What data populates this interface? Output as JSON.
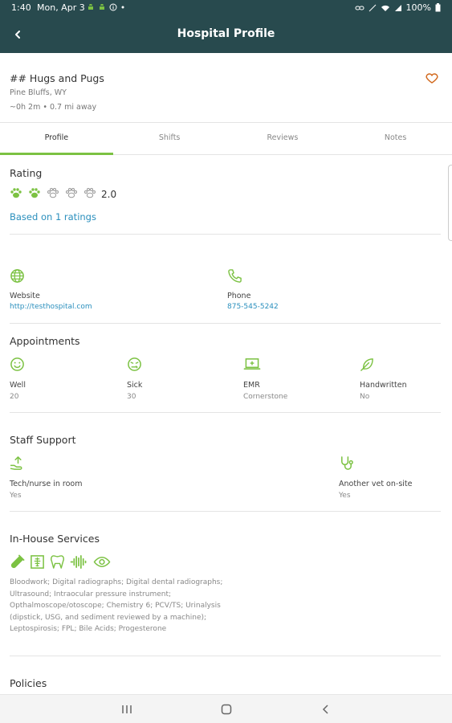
{
  "status_bar": {
    "time": "1:40",
    "date": "Mon, Apr 3",
    "battery": "100%"
  },
  "app_bar": {
    "title": "Hospital Profile"
  },
  "hospital": {
    "name": "## Hugs and Pugs",
    "location": "Pine Bluffs, WY",
    "distance": "~0h 2m • 0.7 mi away"
  },
  "tabs": [
    "Profile",
    "Shifts",
    "Reviews",
    "Notes"
  ],
  "active_tab": "Profile",
  "rating": {
    "title": "Rating",
    "value": "2.0",
    "paws_filled": 2,
    "paws_total": 5,
    "based_on": "Based on 1 ratings"
  },
  "contact": {
    "website_label": "Website",
    "website_value": "http://testhospital.com",
    "phone_label": "Phone",
    "phone_value": "875-545-5242"
  },
  "appointments": {
    "title": "Appointments",
    "items": [
      {
        "label": "Well",
        "value": "20",
        "icon": "smile-icon"
      },
      {
        "label": "Sick",
        "value": "30",
        "icon": "sick-face-icon"
      },
      {
        "label": "EMR",
        "value": "Cornerstone",
        "icon": "laptop-plus-icon"
      },
      {
        "label": "Handwritten",
        "value": "No",
        "icon": "feather-icon"
      }
    ]
  },
  "staff_support": {
    "title": "Staff Support",
    "items": [
      {
        "label": "Tech/nurse in room",
        "value": "Yes",
        "icon": "hand-upload-icon"
      },
      {
        "label": "Another vet on-site",
        "value": "Yes",
        "icon": "stethoscope-icon"
      }
    ]
  },
  "in_house_services": {
    "title": "In-House Services",
    "icons": [
      "test-tube-icon",
      "radiograph-icon",
      "tooth-icon",
      "ultrasound-wave-icon",
      "eye-icon"
    ],
    "description": "Bloodwork; Digital radiographs; Digital dental radiographs; Ultrasound; Intraocular pressure instrument; Opthalmoscope/otoscope; Chemistry 6; PCV/TS; Urinalysis (dipstick, USG, and sediment reviewed by a machine); Leptospirosis; FPL; Bile Acids; Progesterone"
  },
  "policies": {
    "title": "Policies"
  },
  "colors": {
    "header": "#284a4e",
    "accent": "#7cc243",
    "link": "#2a8fbd",
    "heart": "#d2691e"
  }
}
